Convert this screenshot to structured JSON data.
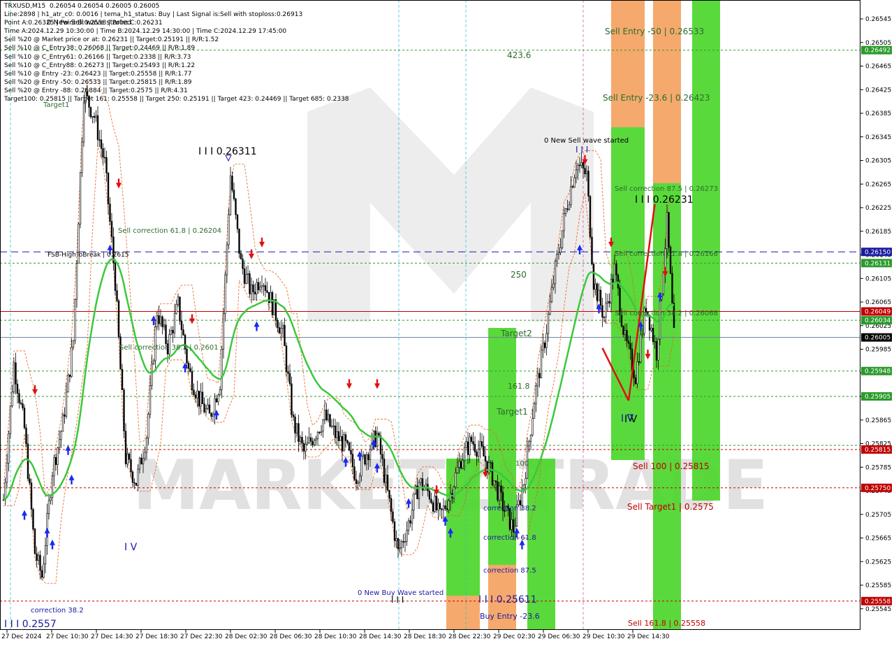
{
  "app": {
    "watermark": "MARKETZITRADE",
    "colors": {
      "bullish_zone": "#4cd62b",
      "bearish_zone": "#f4a261",
      "ema": "#3cc83c",
      "price_line": "#c00000",
      "hline_green": "#2a9a2a",
      "hline_blue": "#1a1aa0",
      "hline_red": "#c00000"
    }
  },
  "info_lines": [
    "TRXUSD,M15  0.26054 0.26054 0.26005 0.26005",
    "Line:2898 | h1_atr_c0: 0.0016 | tema_h1_status: Buy | Last Signal is:Sell with stoploss:0.26913",
    "Point A:0.26325 | Point B:0.2558 | Point C:0.26231",
    "Time A:2024.12.29 10:30:00 | Time B:2024.12.29 14:30:00 | Time C:2024.12.29 17:45:00",
    "Sell %20 @ Market price or at: 0.26231 || Target:0.25191 || R/R:1.52",
    "Sell %10 @ C_Entry38: 0.26068 || Target:0.24469 || R/R:1.89",
    "Sell %10 @ C_Entry61: 0.26166 || Target:0.2338 || R/R:3.73",
    "Sell %10 @ C_Entry88: 0.26273 || Target:0.25493 || R/R:1.22",
    "Sell %10 @ Entry -23: 0.26423 || Target:0.25558 || R/R:1.77",
    "Sell %20 @ Entry -50: 0.26533 || Target:0.25815 || R/R:1.89",
    "Sell %20 @ Entry -88: 0.26884 || Target:0.2575 || R/R:4.31",
    "Target100: 0.25815 || Target 161: 0.25558 || Target 250: 0.25191 || Target 423: 0.24469 || Target 685: 0.2338"
  ],
  "chart_data": {
    "type": "candlestick",
    "symbol": "TRXUSD,M15",
    "ylim": [
      0.25534,
      0.26572
    ],
    "y_ticks": [
      "0.26545",
      "0.26505",
      "0.26465",
      "0.26425",
      "0.26385",
      "0.26345",
      "0.26305",
      "0.26265",
      "0.26225",
      "0.26185",
      "0.26145",
      "0.26105",
      "0.26065",
      "0.26025",
      "0.25985",
      "0.25945",
      "0.25905",
      "0.25865",
      "0.25825",
      "0.25785",
      "0.25745",
      "0.25705",
      "0.25665",
      "0.25625",
      "0.25585",
      "0.25545"
    ],
    "x_ticks": [
      "27 Dec 2024",
      "27 Dec 10:30",
      "27 Dec 14:30",
      "27 Dec 18:30",
      "27 Dec 22:30",
      "28 Dec 02:30",
      "28 Dec 06:30",
      "28 Dec 10:30",
      "28 Dec 14:30",
      "28 Dec 18:30",
      "28 Dec 22:30",
      "29 Dec 02:30",
      "29 Dec 06:30",
      "29 Dec 10:30",
      "29 Dec 14:30"
    ],
    "current_price": 0.26005,
    "price_tags": [
      {
        "value": "0.26492",
        "price": 0.26492,
        "color": "#2a9a2a"
      },
      {
        "value": "0.26150",
        "price": 0.2615,
        "color": "#1a1aa0"
      },
      {
        "value": "0.26131",
        "price": 0.26131,
        "color": "#2a9a2a"
      },
      {
        "value": "0.26049",
        "price": 0.26049,
        "color": "#c00000"
      },
      {
        "value": "0.26034",
        "price": 0.26034,
        "color": "#2a9a2a"
      },
      {
        "value": "0.26005",
        "price": 0.26005,
        "color": "#000000"
      },
      {
        "value": "0.25948",
        "price": 0.25948,
        "color": "#2a9a2a"
      },
      {
        "value": "0.25905",
        "price": 0.25905,
        "color": "#2a9a2a"
      },
      {
        "value": "0.25815",
        "price": 0.25815,
        "color": "#c00000"
      },
      {
        "value": "0.25750",
        "price": 0.2575,
        "color": "#c00000"
      },
      {
        "value": "0.25558",
        "price": 0.25558,
        "color": "#c00000"
      }
    ],
    "hlines": [
      {
        "price": 0.26492,
        "color": "#2a9a2a",
        "style": "dotted"
      },
      {
        "price": 0.2615,
        "color": "#1a1aa0",
        "style": "dashed"
      },
      {
        "price": 0.26131,
        "color": "#2a9a2a",
        "style": "dotted"
      },
      {
        "price": 0.26049,
        "color": "#c00000",
        "style": "solid"
      },
      {
        "price": 0.26034,
        "color": "#2a9a2a",
        "style": "dotted"
      },
      {
        "price": 0.26005,
        "color": "#6b7f99",
        "style": "solid"
      },
      {
        "price": 0.25948,
        "color": "#2a9a2a",
        "style": "dotted"
      },
      {
        "price": 0.25905,
        "color": "#2a9a2a",
        "style": "dotted"
      },
      {
        "price": 0.25822,
        "color": "#2a9a2a",
        "style": "dotted"
      },
      {
        "price": 0.25815,
        "color": "#c00000",
        "style": "dotted"
      },
      {
        "price": 0.2575,
        "color": "#c00000",
        "style": "dotted"
      },
      {
        "price": 0.25558,
        "color": "#c00000",
        "style": "dotted"
      }
    ],
    "annotations": [
      {
        "text": "Sell Entry -50 | 0.26533",
        "color": "#2e6b2e"
      },
      {
        "text": "Sell Entry -23.6 | 0.26423",
        "color": "#2e6b2e"
      },
      {
        "text": "423.6",
        "color": "#2e6b2e"
      },
      {
        "text": "0 New Sell wave started",
        "color": "#000000"
      },
      {
        "text": "I I I",
        "color": "#1a1aa0"
      },
      {
        "text": "Sell correction 87.5 | 0.26273",
        "color": "#2e6b2e"
      },
      {
        "text": "I I I 0.26231",
        "color": "#000000"
      },
      {
        "text": "Sell correction 61.8 | 0.26166",
        "color": "#2e6b2e"
      },
      {
        "text": "250",
        "color": "#2e6b2e"
      },
      {
        "text": "Sell correction 38.2 | 0.26068",
        "color": "#2e6b2e"
      },
      {
        "text": "Target2",
        "color": "#2e6b2e"
      },
      {
        "text": "161.8",
        "color": "#2e6b2e"
      },
      {
        "text": "Target1",
        "color": "#2e6b2e"
      },
      {
        "text": "I V",
        "color": "#1a1aa0"
      },
      {
        "text": "Sell 100 | 0.25815",
        "color": "#c00000"
      },
      {
        "text": "100",
        "color": "#2e6b2e"
      },
      {
        "text": "Sell Target1 | 0.2575",
        "color": "#c00000"
      },
      {
        "text": "correction 38.2",
        "color": "#1a1aa0"
      },
      {
        "text": "correction 61.8",
        "color": "#1a1aa0"
      },
      {
        "text": "correction 87.5",
        "color": "#1a1aa0"
      },
      {
        "text": "I I I 0.25611",
        "color": "#1a1aa0"
      },
      {
        "text": "Buy Entry -23.6",
        "color": "#1a1aa0"
      },
      {
        "text": "Sell 161.8 | 0.25558",
        "color": "#c00000"
      },
      {
        "text": "0 New Buy Wave started",
        "color": "#1a1aa0"
      },
      {
        "text": "I I I",
        "color": "#000000"
      },
      {
        "text": "I I I 0.26311",
        "color": "#000000"
      },
      {
        "text": "I V",
        "color": "#1a1aa0"
      },
      {
        "text": "Sell correction 61.8 | 0.26204",
        "color": "#2e6b2e"
      },
      {
        "text": "FSB-HighToBreak | 0.2615",
        "color": "#000000"
      },
      {
        "text": "Sell correction 38.2 | 0.2601",
        "color": "#2e6b2e"
      },
      {
        "text": "correction 38.2",
        "color": "#1a1aa0"
      },
      {
        "text": "I I I 0.2557",
        "color": "#1a1aa0"
      },
      {
        "text": "0 New Sell wave started",
        "color": "#000000"
      },
      {
        "text": "I V",
        "color": "#000000"
      },
      {
        "text": "Target1",
        "color": "#2e6b2e"
      }
    ]
  }
}
